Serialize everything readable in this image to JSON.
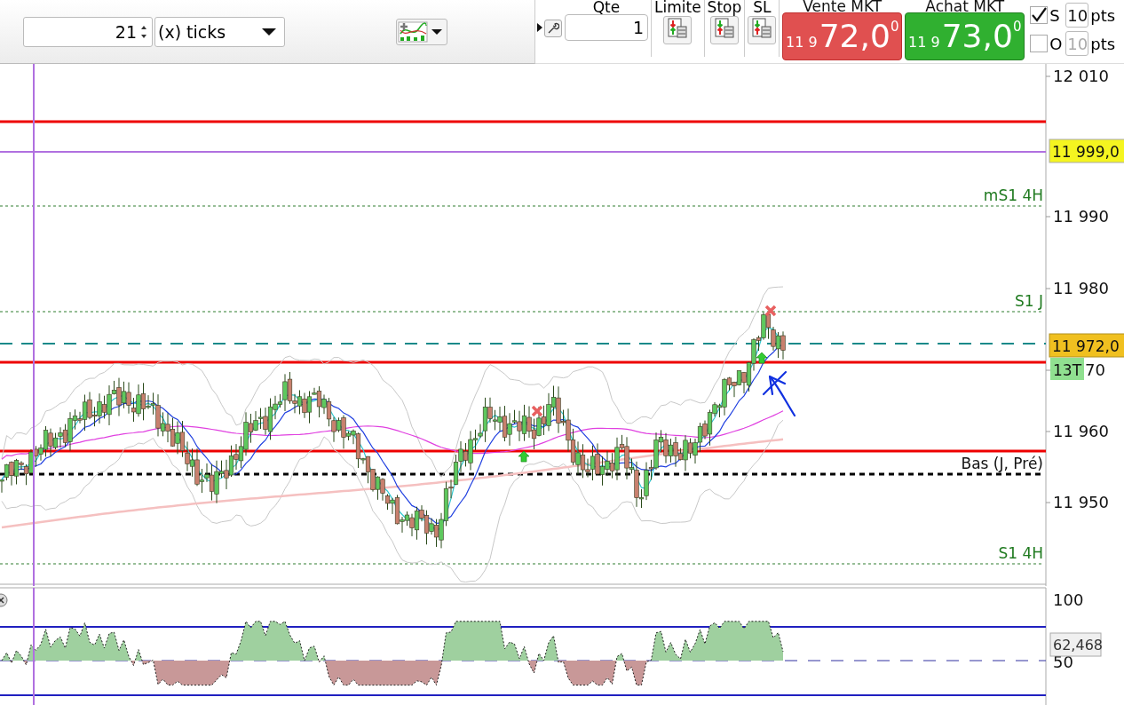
{
  "toolbar": {
    "period_value": "21",
    "period_unit": "(x) ticks"
  },
  "order_panel": {
    "quantity_label": "Qte",
    "quantity": "1",
    "order_types": [
      {
        "label": "Limite",
        "kind": "limit"
      },
      {
        "label": "Stop",
        "kind": "stop"
      },
      {
        "label": "SL",
        "kind": "stoplimit"
      }
    ],
    "market_buttons": [
      {
        "label": "Vente MKT",
        "kind": "sell",
        "price_prefix": "11 9",
        "price_main": "72,0",
        "price_sup": "0"
      },
      {
        "label": "Achat MKT",
        "kind": "buy",
        "price_prefix": "11 9",
        "price_main": "73,0",
        "price_sup": "0"
      }
    ],
    "options": [
      {
        "label": "S",
        "checked": true,
        "value": "10",
        "unit": "pts",
        "disabled": false
      },
      {
        "label": "O",
        "checked": false,
        "value": "10",
        "unit": "pts",
        "disabled": true
      }
    ]
  },
  "price_chart": {
    "y_ticks": [
      "12 010",
      "11 990",
      "11 980",
      "70",
      "11 960",
      "11 950"
    ],
    "levels": [
      {
        "label": "mS1 4H",
        "kind": "pivot"
      },
      {
        "label": "S1 J",
        "kind": "pivot"
      },
      {
        "label": "Bas (J, Pré)",
        "kind": "low"
      },
      {
        "label": "S1 4H",
        "kind": "pivot"
      }
    ],
    "price_tags": [
      {
        "label": "11 999,0",
        "kind": "alert"
      },
      {
        "label": "11 972,0",
        "kind": "last"
      }
    ],
    "badge": "13T"
  },
  "oscillator": {
    "y_ticks": [
      "100",
      "50"
    ],
    "reading": "62,468"
  }
}
